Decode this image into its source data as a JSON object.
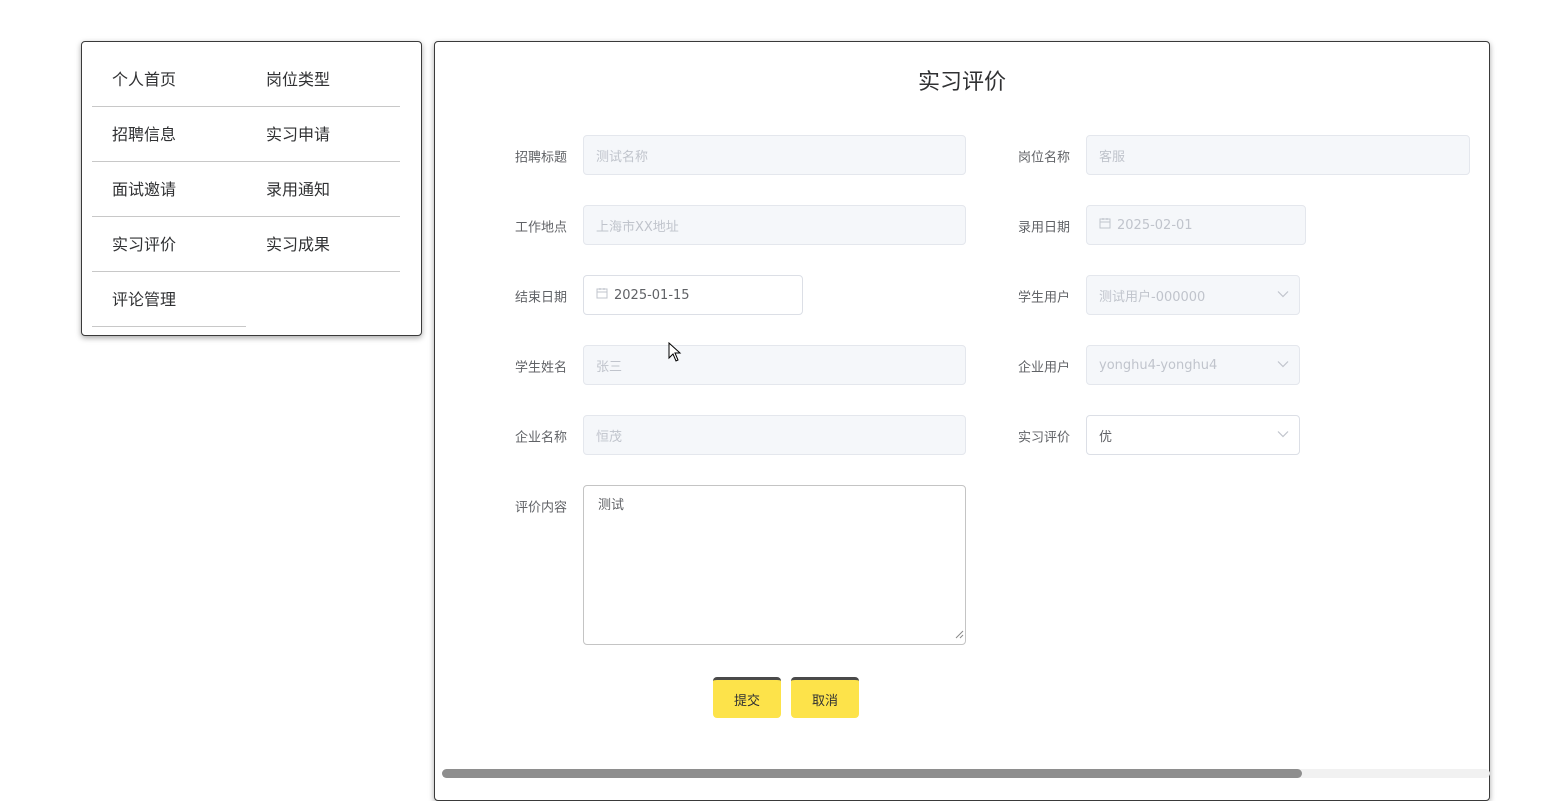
{
  "menu": {
    "items": [
      {
        "label": "个人首页"
      },
      {
        "label": "岗位类型"
      },
      {
        "label": "招聘信息"
      },
      {
        "label": "实习申请"
      },
      {
        "label": "面试邀请"
      },
      {
        "label": "录用通知"
      },
      {
        "label": "实习评价"
      },
      {
        "label": "实习成果"
      },
      {
        "label": "评论管理"
      }
    ]
  },
  "form": {
    "title": "实习评价",
    "fields": {
      "recruit_title": {
        "label": "招聘标题",
        "value": "测试名称"
      },
      "position_name": {
        "label": "岗位名称",
        "value": "客服"
      },
      "work_location": {
        "label": "工作地点",
        "value": "上海市XX地址"
      },
      "hire_date": {
        "label": "录用日期",
        "value": "2025-02-01"
      },
      "end_date": {
        "label": "结束日期",
        "value": "2025-01-15"
      },
      "student_user": {
        "label": "学生用户",
        "value": "测试用户-000000"
      },
      "student_name": {
        "label": "学生姓名",
        "value": "张三"
      },
      "company_user": {
        "label": "企业用户",
        "value": "yonghu4-yonghu4"
      },
      "company_name": {
        "label": "企业名称",
        "value": "恒茂"
      },
      "internship_rating": {
        "label": "实习评价",
        "value": "优"
      },
      "evaluation_content": {
        "label": "评价内容",
        "value": "测试"
      }
    },
    "buttons": {
      "submit": "提交",
      "cancel": "取消"
    }
  },
  "icons": {
    "calendar": "calendar-icon",
    "dropdown": "chevron-down-icon",
    "cursor": "mouse-pointer-icon"
  },
  "colors": {
    "button_bg": "#fde34a",
    "disabled_bg": "#f5f7fa",
    "disabled_text": "#c0c4cc",
    "active_text": "#606266"
  }
}
